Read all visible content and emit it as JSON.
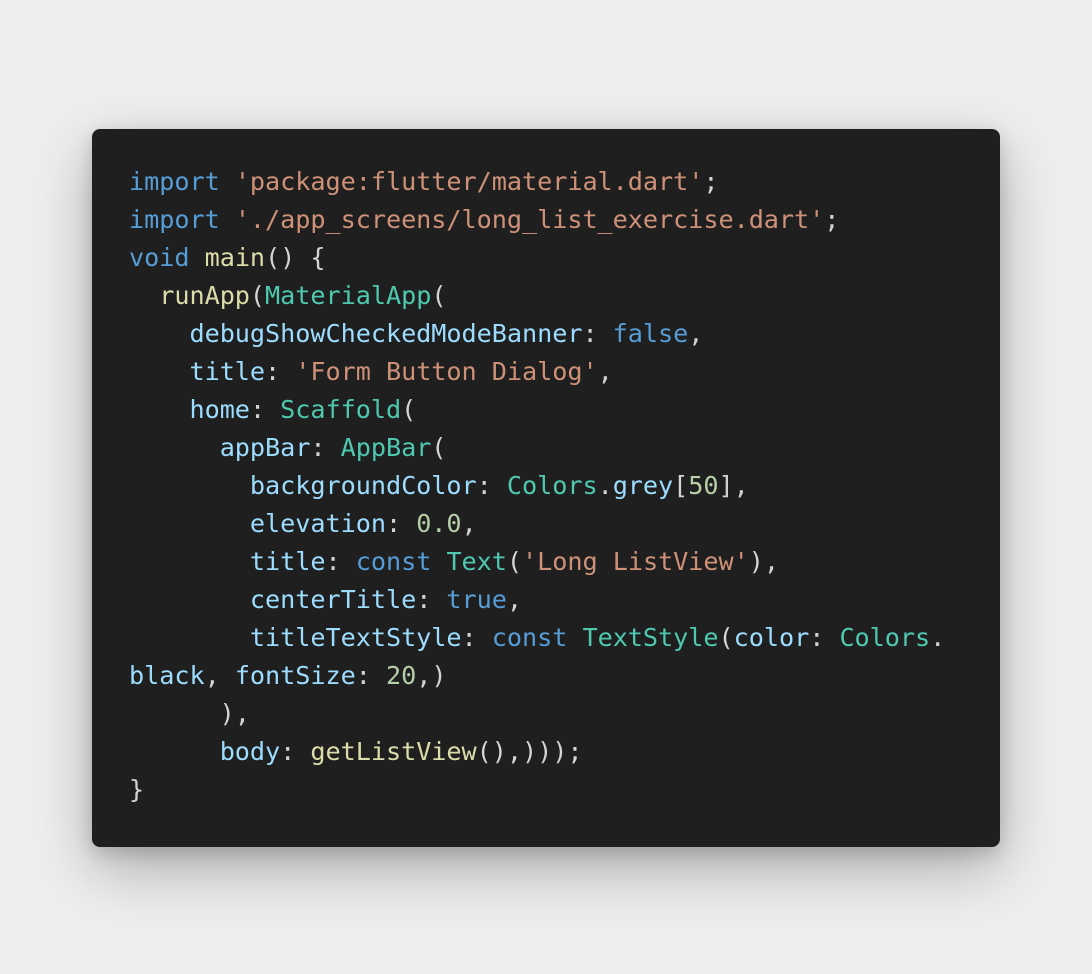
{
  "colors": {
    "page_background": "#eeeeee",
    "card_background": "#1f1f1f",
    "keyword": "#569cd6",
    "string": "#ce9178",
    "function": "#dcdcaa",
    "class": "#4ec9b0",
    "property": "#9cdcfe",
    "number": "#b5cea8",
    "punctuation": "#d4d4d4"
  },
  "code": {
    "language": "dart",
    "lines": [
      {
        "tokens": [
          {
            "t": "import",
            "k": "keyword"
          },
          {
            "t": " ",
            "k": "punctuation"
          },
          {
            "t": "'package:flutter/material.dart'",
            "k": "string"
          },
          {
            "t": ";",
            "k": "punctuation"
          }
        ]
      },
      {
        "tokens": [
          {
            "t": "import",
            "k": "keyword"
          },
          {
            "t": " ",
            "k": "punctuation"
          },
          {
            "t": "'./app_screens/long_list_exercise.dart'",
            "k": "string"
          },
          {
            "t": ";",
            "k": "punctuation"
          }
        ]
      },
      {
        "tokens": [
          {
            "t": "void",
            "k": "keyword"
          },
          {
            "t": " ",
            "k": "punctuation"
          },
          {
            "t": "main",
            "k": "function"
          },
          {
            "t": "() {",
            "k": "punctuation"
          }
        ]
      },
      {
        "tokens": [
          {
            "t": "  ",
            "k": "punctuation"
          },
          {
            "t": "runApp",
            "k": "function"
          },
          {
            "t": "(",
            "k": "punctuation"
          },
          {
            "t": "MaterialApp",
            "k": "class"
          },
          {
            "t": "(",
            "k": "punctuation"
          }
        ]
      },
      {
        "tokens": [
          {
            "t": "    ",
            "k": "punctuation"
          },
          {
            "t": "debugShowCheckedModeBanner",
            "k": "property"
          },
          {
            "t": ": ",
            "k": "punctuation"
          },
          {
            "t": "false",
            "k": "keyword"
          },
          {
            "t": ",",
            "k": "punctuation"
          }
        ]
      },
      {
        "tokens": [
          {
            "t": "    ",
            "k": "punctuation"
          },
          {
            "t": "title",
            "k": "property"
          },
          {
            "t": ": ",
            "k": "punctuation"
          },
          {
            "t": "'Form Button Dialog'",
            "k": "string"
          },
          {
            "t": ",",
            "k": "punctuation"
          }
        ]
      },
      {
        "tokens": [
          {
            "t": "    ",
            "k": "punctuation"
          },
          {
            "t": "home",
            "k": "property"
          },
          {
            "t": ": ",
            "k": "punctuation"
          },
          {
            "t": "Scaffold",
            "k": "class"
          },
          {
            "t": "(",
            "k": "punctuation"
          }
        ]
      },
      {
        "tokens": [
          {
            "t": "      ",
            "k": "punctuation"
          },
          {
            "t": "appBar",
            "k": "property"
          },
          {
            "t": ": ",
            "k": "punctuation"
          },
          {
            "t": "AppBar",
            "k": "class"
          },
          {
            "t": "(",
            "k": "punctuation"
          }
        ]
      },
      {
        "tokens": [
          {
            "t": "        ",
            "k": "punctuation"
          },
          {
            "t": "backgroundColor",
            "k": "property"
          },
          {
            "t": ": ",
            "k": "punctuation"
          },
          {
            "t": "Colors",
            "k": "class"
          },
          {
            "t": ".",
            "k": "punctuation"
          },
          {
            "t": "grey",
            "k": "property"
          },
          {
            "t": "[",
            "k": "punctuation"
          },
          {
            "t": "50",
            "k": "number"
          },
          {
            "t": "],",
            "k": "punctuation"
          }
        ]
      },
      {
        "tokens": [
          {
            "t": "        ",
            "k": "punctuation"
          },
          {
            "t": "elevation",
            "k": "property"
          },
          {
            "t": ": ",
            "k": "punctuation"
          },
          {
            "t": "0.0",
            "k": "number"
          },
          {
            "t": ",",
            "k": "punctuation"
          }
        ]
      },
      {
        "tokens": [
          {
            "t": "        ",
            "k": "punctuation"
          },
          {
            "t": "title",
            "k": "property"
          },
          {
            "t": ": ",
            "k": "punctuation"
          },
          {
            "t": "const",
            "k": "keyword"
          },
          {
            "t": " ",
            "k": "punctuation"
          },
          {
            "t": "Text",
            "k": "class"
          },
          {
            "t": "(",
            "k": "punctuation"
          },
          {
            "t": "'Long ListView'",
            "k": "string"
          },
          {
            "t": "),",
            "k": "punctuation"
          }
        ]
      },
      {
        "tokens": [
          {
            "t": "        ",
            "k": "punctuation"
          },
          {
            "t": "centerTitle",
            "k": "property"
          },
          {
            "t": ": ",
            "k": "punctuation"
          },
          {
            "t": "true",
            "k": "keyword"
          },
          {
            "t": ",",
            "k": "punctuation"
          }
        ]
      },
      {
        "tokens": [
          {
            "t": "        ",
            "k": "punctuation"
          },
          {
            "t": "titleTextStyle",
            "k": "property"
          },
          {
            "t": ": ",
            "k": "punctuation"
          },
          {
            "t": "const",
            "k": "keyword"
          },
          {
            "t": " ",
            "k": "punctuation"
          },
          {
            "t": "TextStyle",
            "k": "class"
          },
          {
            "t": "(",
            "k": "punctuation"
          },
          {
            "t": "color",
            "k": "property"
          },
          {
            "t": ": ",
            "k": "punctuation"
          },
          {
            "t": "Colors",
            "k": "class"
          },
          {
            "t": ".",
            "k": "punctuation"
          }
        ]
      },
      {
        "tokens": [
          {
            "t": "black",
            "k": "property"
          },
          {
            "t": ", ",
            "k": "punctuation"
          },
          {
            "t": "fontSize",
            "k": "property"
          },
          {
            "t": ": ",
            "k": "punctuation"
          },
          {
            "t": "20",
            "k": "number"
          },
          {
            "t": ",)",
            "k": "punctuation"
          }
        ]
      },
      {
        "tokens": [
          {
            "t": "      ),",
            "k": "punctuation"
          }
        ]
      },
      {
        "tokens": [
          {
            "t": "      ",
            "k": "punctuation"
          },
          {
            "t": "body",
            "k": "property"
          },
          {
            "t": ": ",
            "k": "punctuation"
          },
          {
            "t": "getListView",
            "k": "function"
          },
          {
            "t": "(),)));",
            "k": "punctuation"
          }
        ]
      },
      {
        "tokens": [
          {
            "t": "}",
            "k": "punctuation"
          }
        ]
      }
    ]
  }
}
